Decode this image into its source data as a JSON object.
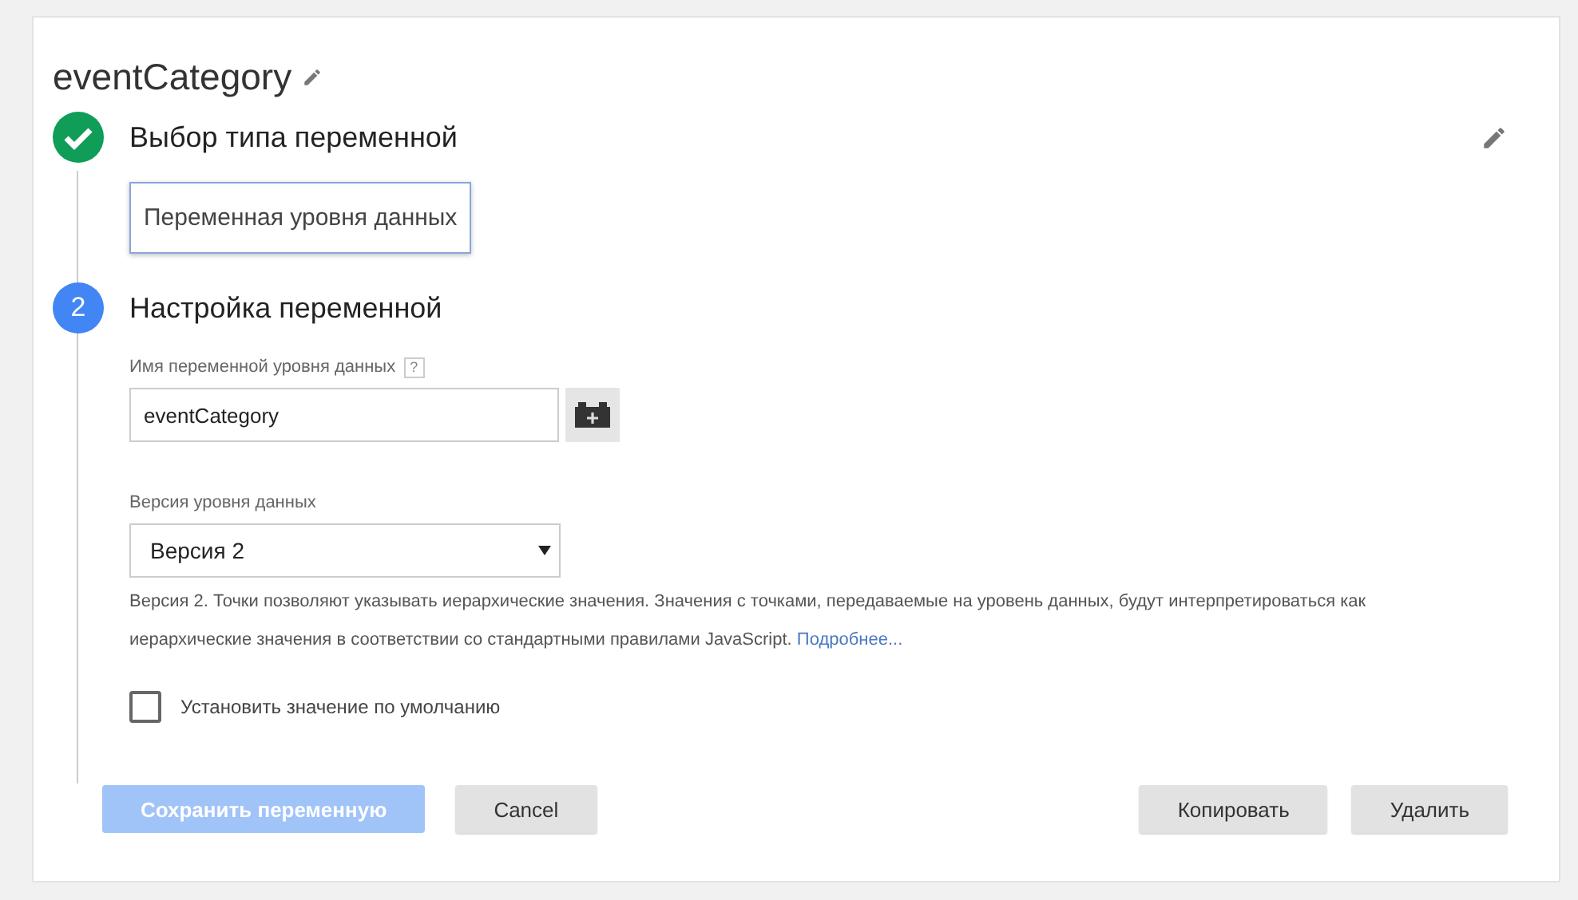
{
  "title": "eventCategory",
  "steps": [
    {
      "kind": "done",
      "heading": "Выбор типа переменной"
    },
    {
      "kind": "active",
      "number": "2",
      "heading": "Настройка переменной"
    }
  ],
  "variable_type": "Переменная уровня данных",
  "name_field": {
    "label": "Имя переменной уровня данных",
    "help": "?",
    "value": "eventCategory"
  },
  "version_select": {
    "label": "Версия уровня данных",
    "value": "Версия 2"
  },
  "description": {
    "text": "Версия 2. Точки позволяют указывать иерархические значения. Значения с точками, передаваемые на уровень данных, будут интерпретироваться как иерархические значения в соответствии со стандартными правилами JavaScript.",
    "link": "Подробнее..."
  },
  "default_checkbox": {
    "label": "Установить значение по умолчанию",
    "checked": false
  },
  "buttons": [
    {
      "label": "Сохранить переменную",
      "kind": "primary",
      "disabled": true
    },
    {
      "label": "Cancel",
      "kind": "plain",
      "disabled": false
    }
  ],
  "right_buttons": [
    {
      "label": "Копировать",
      "disabled": false
    },
    {
      "label": "Удалить",
      "disabled": false
    }
  ]
}
